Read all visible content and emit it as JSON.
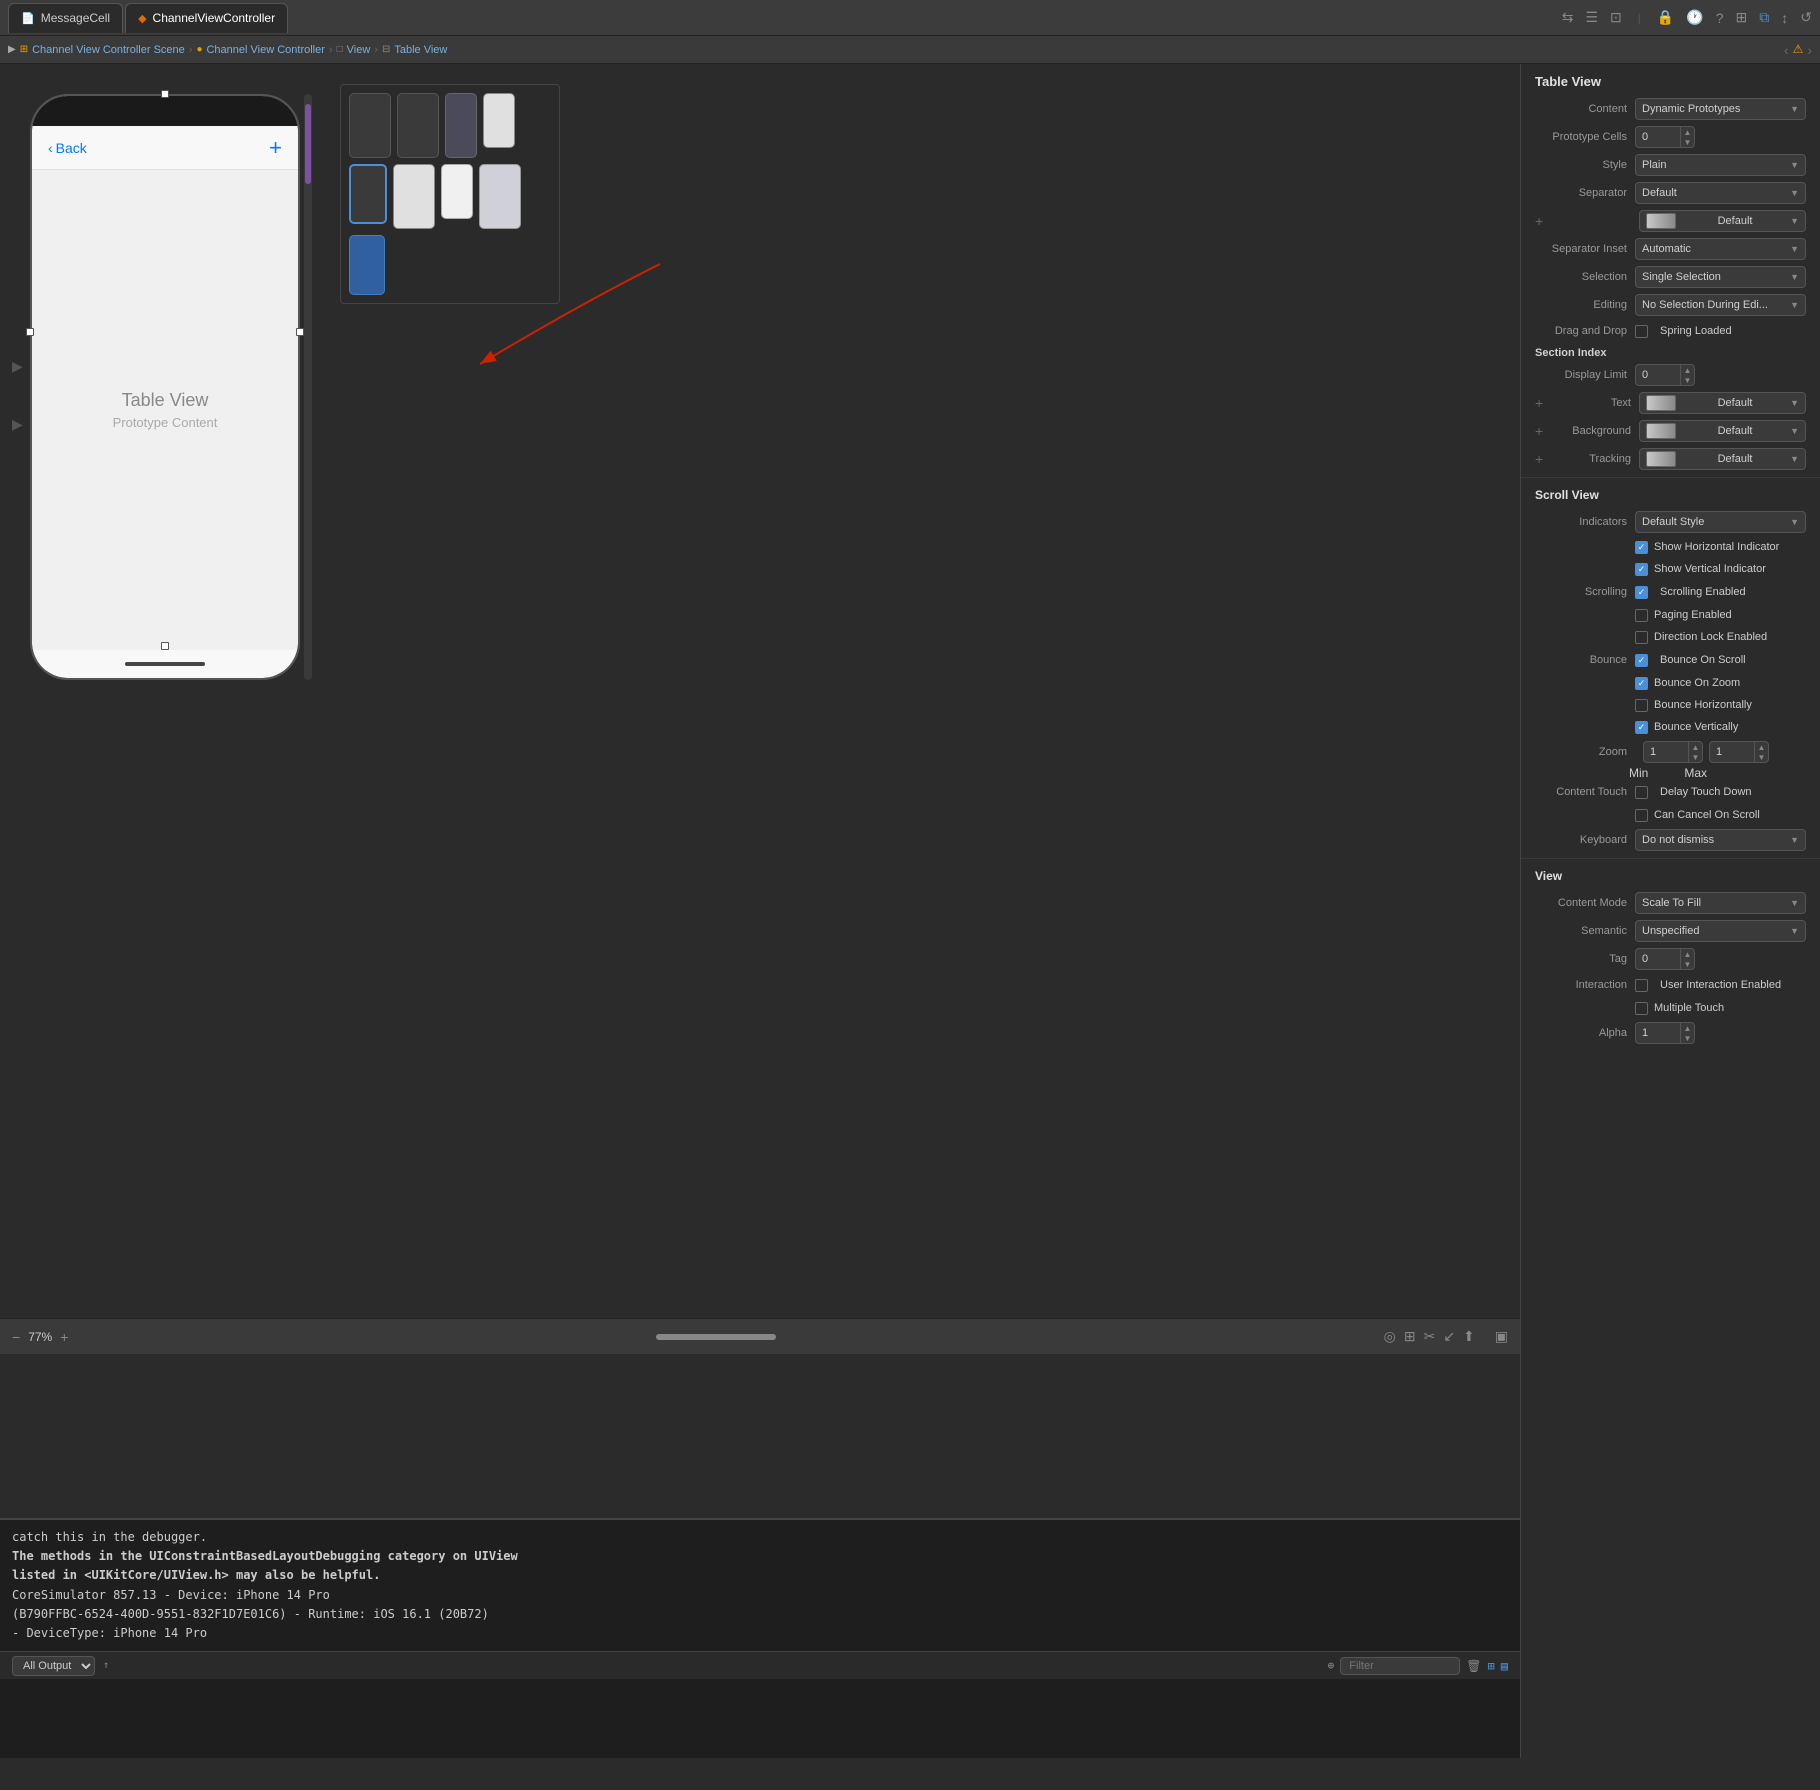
{
  "tabs": [
    {
      "id": "message-cell",
      "label": "MessageCell",
      "active": false,
      "icon": "file"
    },
    {
      "id": "channel-view-controller",
      "label": "ChannelViewController",
      "active": true,
      "icon": "swift"
    }
  ],
  "toolbar": {
    "icons": [
      "back-forward",
      "list",
      "window"
    ]
  },
  "breadcrumb": {
    "items": [
      {
        "label": "Channel View Controller Scene",
        "icon": "scene"
      },
      {
        "label": "Channel View Controller",
        "icon": "controller"
      },
      {
        "label": "View",
        "icon": "view"
      },
      {
        "label": "Table View",
        "icon": "tableview"
      }
    ]
  },
  "canvas": {
    "title": "Table View",
    "phone": {
      "back_label": "Back",
      "table_view_label": "Table View",
      "prototype_content_label": "Prototype Content"
    }
  },
  "zoom": {
    "level": "77%"
  },
  "console": {
    "lines": [
      "catch this in the debugger.",
      "The methods in the UIConstraintBasedLayoutDebugging category on UIView",
      "listed in <UIKitCore/UIView.h> may also be helpful.",
      "CoreSimulator 857.13 - Device: iPhone 14 Pro",
      "(B790FFBC-6524-400D-9551-832F1D7E01C6) - Runtime: iOS 16.1 (20B72)",
      "- DeviceType: iPhone 14 Pro"
    ],
    "output_label": "All Output",
    "filter_placeholder": "Filter"
  },
  "right_panel": {
    "section_table_view": {
      "title": "Table View",
      "properties": {
        "content": {
          "label": "Content",
          "value": "Dynamic Prototypes"
        },
        "prototype_cells": {
          "label": "Prototype Cells",
          "value": "0"
        },
        "style": {
          "label": "Style",
          "value": "Plain"
        },
        "separator": {
          "label": "Separator",
          "value": "Default"
        },
        "separator_color": {
          "label": "",
          "value": "Default"
        },
        "separator_inset": {
          "label": "Separator Inset",
          "value": "Automatic"
        },
        "selection": {
          "label": "Selection",
          "value": "Single Selection"
        },
        "editing": {
          "label": "Editing",
          "value": "No Selection During Edi..."
        },
        "drag_drop_label": "Drag and Drop",
        "spring_loaded_label": "Spring Loaded",
        "section_index_label": "Section Index",
        "display_limit": {
          "label": "Display Limit",
          "value": "0"
        },
        "text": {
          "label": "Text",
          "value": "Default"
        },
        "background": {
          "label": "Background",
          "value": "Default"
        },
        "tracking": {
          "label": "Tracking",
          "value": "Default"
        }
      }
    },
    "section_scroll_view": {
      "title": "Scroll View",
      "properties": {
        "indicators": {
          "label": "Indicators",
          "value": "Default Style"
        }
      },
      "checkboxes": {
        "show_horizontal": {
          "label": "Show Horizontal Indicator",
          "checked": true
        },
        "show_vertical": {
          "label": "Show Vertical Indicator",
          "checked": true
        },
        "scrolling_enabled": {
          "label": "Scrolling Enabled",
          "checked": true
        },
        "paging_enabled": {
          "label": "Paging Enabled",
          "checked": false
        },
        "direction_lock": {
          "label": "Direction Lock Enabled",
          "checked": false
        },
        "bounce_on_scroll": {
          "label": "Bounce On Scroll",
          "checked": true
        },
        "bounce_on_zoom": {
          "label": "Bounce On Zoom",
          "checked": true
        },
        "bounce_horizontally": {
          "label": "Bounce Horizontally",
          "checked": false
        },
        "bounce_vertically": {
          "label": "Bounce Vertically",
          "checked": true
        }
      },
      "scrolling_label": "Scrolling",
      "bounce_label": "Bounce",
      "zoom_label": "Zoom",
      "zoom_min": "1",
      "zoom_max": "1",
      "zoom_min_sub": "Min",
      "zoom_max_sub": "Max",
      "content_touch_label": "Content Touch",
      "delay_touch_down": {
        "label": "Delay Touch Down",
        "checked": false
      },
      "can_cancel_on_scroll": {
        "label": "Can Cancel On Scroll",
        "checked": false
      },
      "keyboard_label": "Keyboard",
      "keyboard_value": "Do not dismiss"
    },
    "section_view": {
      "title": "View",
      "content_mode": {
        "label": "Content Mode",
        "value": "Scale To Fill"
      },
      "semantic": {
        "label": "Semantic",
        "value": "Unspecified"
      },
      "tag": {
        "label": "Tag",
        "value": "0"
      },
      "interaction_label": "Interaction",
      "user_interaction": {
        "label": "User Interaction Enabled",
        "checked": false
      },
      "multiple_touch": {
        "label": "Multiple Touch",
        "checked": false
      },
      "alpha_label": "Alpha"
    }
  }
}
